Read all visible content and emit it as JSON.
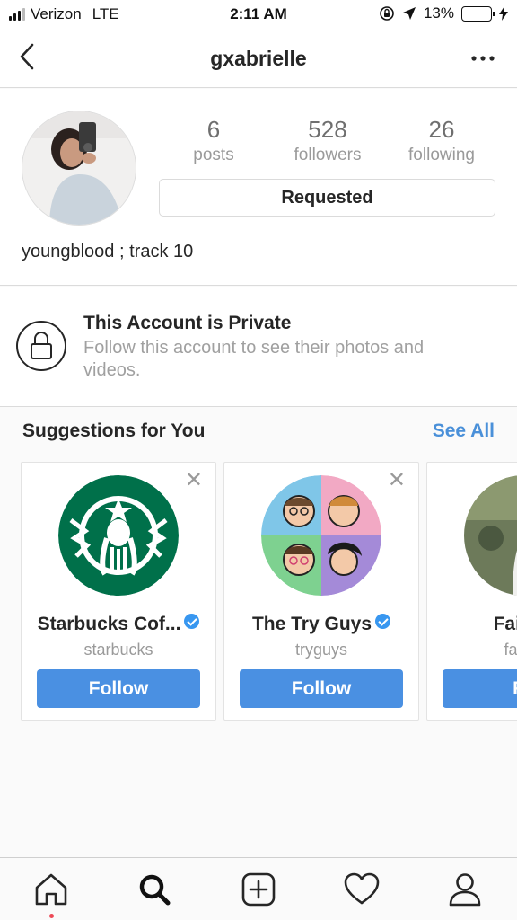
{
  "status_bar": {
    "carrier": "Verizon",
    "network": "LTE",
    "time": "2:11 AM",
    "battery_percent": "13%",
    "battery_level": 0.13,
    "battery_color": "#f5c518"
  },
  "header": {
    "username": "gxabrielle",
    "back_icon": "chevron-left-icon",
    "more_icon": "more-horizontal-icon"
  },
  "profile": {
    "stats": [
      {
        "value": "6",
        "label": "posts"
      },
      {
        "value": "528",
        "label": "followers"
      },
      {
        "value": "26",
        "label": "following"
      }
    ],
    "requested_label": "Requested",
    "bio": "youngblood ; track 10"
  },
  "private_notice": {
    "title": "This Account is Private",
    "subtitle": "Follow this account to see their photos and videos."
  },
  "suggestions": {
    "title": "Suggestions for You",
    "see_all": "See All",
    "cards": [
      {
        "name": "Starbucks Cof...",
        "handle": "starbucks",
        "verified": true,
        "follow_label": "Follow"
      },
      {
        "name": "The Try Guys",
        "handle": "tryguys",
        "verified": true,
        "follow_label": "Follow"
      },
      {
        "name": "Fairbai",
        "handle": "fairba",
        "verified": false,
        "follow_label": "Fo"
      }
    ]
  },
  "tab_bar": {
    "tabs": [
      "home-icon",
      "search-icon",
      "new-post-icon",
      "activity-heart-icon",
      "profile-icon"
    ],
    "accent_color": "#ed4956"
  },
  "colors": {
    "follow_blue": "#4a90e2",
    "link_blue": "#4a90d9"
  }
}
